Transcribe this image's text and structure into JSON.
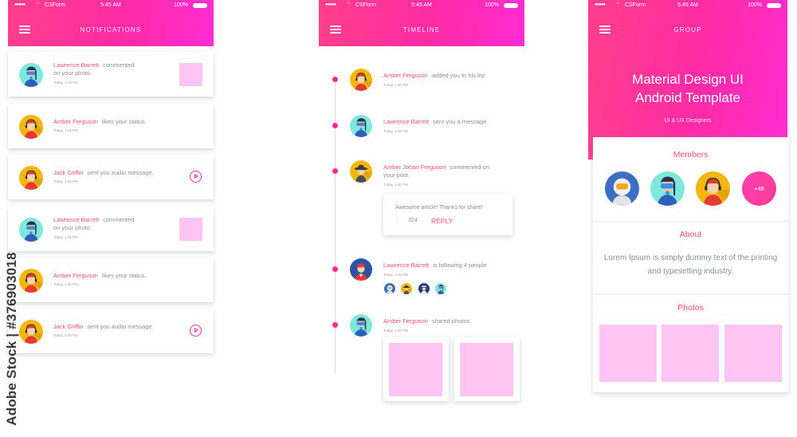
{
  "status_bar": {
    "signal": "●●●●●",
    "carrier": "CSForm",
    "time": "5:45 AM",
    "battery": "100%"
  },
  "colors": {
    "accent": "#f0506e",
    "gradient_start": "#ff3f8a",
    "gradient_end": "#ff2dd2",
    "thumb": "#ffc4f1",
    "timeline_dot": "#ff2d8f"
  },
  "notifications_screen": {
    "title": "NOTIFICATIONS",
    "items": [
      {
        "name": "Lawrence Barrett",
        "text": "commented",
        "text2": "on your photo.",
        "time": "Today, 1:45 PM",
        "avatar": "diver",
        "trailing": "photo-thumbnail"
      },
      {
        "name": "Amber Ferguson",
        "text": "likes your status.",
        "text2": "",
        "time": "Today, 1:45 PM",
        "avatar": "headset-person",
        "trailing": ""
      },
      {
        "name": "Jack Griffin",
        "text": "sent you audio message.",
        "text2": "",
        "time": "Today, 1:45 PM",
        "avatar": "headset-person",
        "trailing": "play-icon"
      },
      {
        "name": "Lawrence Barrett",
        "text": "commented",
        "text2": "on your photo.",
        "time": "Today, 1:45 PM",
        "avatar": "diver",
        "trailing": "photo-thumbnail"
      },
      {
        "name": "Amber Ferguson",
        "text": "likes your status.",
        "text2": "",
        "time": "Today, 1:45 PM",
        "avatar": "headset-person",
        "trailing": ""
      },
      {
        "name": "Jack Griffin",
        "text": "sent you audio message.",
        "text2": "",
        "time": "Today, 1:45 PM",
        "avatar": "headset-person",
        "trailing": "play-icon"
      }
    ]
  },
  "timeline_screen": {
    "title": "TIMELINE",
    "items": [
      {
        "name": "Amber Ferguson",
        "text": "added you to his list",
        "time": "Today, 1:45 PM",
        "avatar": "headset-person"
      },
      {
        "name": "Lawrence Barrett",
        "text": "sent you a message",
        "time": "Today, 1:45 PM",
        "avatar": "diver"
      },
      {
        "name": "Amber Johan Ferguson",
        "text": "commented on",
        "text2": "your post.",
        "time": "Today, 1:45 PM",
        "avatar": "spy"
      },
      {
        "name": "Lawrence Barrett",
        "text": "is following 4 people",
        "time": "Today, 1:45 PM",
        "avatar": "sailor"
      },
      {
        "name": "Amber Ferguson",
        "text": "shared photos",
        "time": "Today, 1:45 PM",
        "avatar": "diver"
      }
    ],
    "comment": {
      "text": "Awesome article! Thanks for share!",
      "likes": "324",
      "reply_label": "REPLY"
    },
    "following_avatars": [
      "astronaut",
      "spy",
      "captain",
      "diver"
    ]
  },
  "group_screen": {
    "title": "GROUP",
    "heading_line1": "Material Design UI",
    "heading_line2": "Android Template",
    "subtitle": "UI & UX Designers",
    "members_title": "Members",
    "members": [
      "astronaut",
      "diver",
      "headset-person"
    ],
    "more_members": "+48",
    "about_title": "About",
    "about_text": "Lorem Ipsum is simply dummy text of the printing and typesetting industry.",
    "photos_title": "Photos"
  },
  "watermark": "Adobe Stock | #376903018"
}
